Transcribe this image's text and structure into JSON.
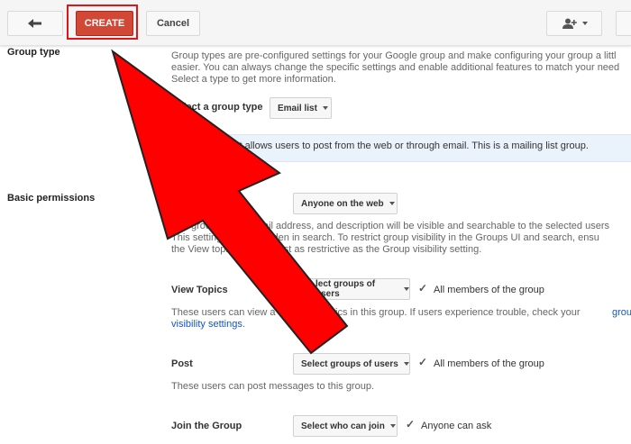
{
  "toolbar": {
    "back_icon": "arrow-left-icon",
    "create_label": "CREATE",
    "cancel_label": "Cancel",
    "people_icon": "person-add-icon",
    "accent": "#d14836",
    "highlight": "#e0151b"
  },
  "group_type": {
    "heading": "Group type",
    "desc_line1": "Group types are pre-configured settings for your Google group and make configuring your group a littl",
    "desc_line2": "easier. You can always change the specific settings and enable additional features to match your need",
    "desc_line3": "Select a type to get more information.",
    "select_label": "Select a group type",
    "select_value": "Email list",
    "info_text": "st allows users to post from the web or through email. This is a mailing list group."
  },
  "basic_permissions": {
    "heading": "Basic permissions",
    "visibility": {
      "label_fragment": "G",
      "select_value": "Anyone on the web",
      "desc_line1_a": "The group",
      "desc_line1_b": "ail address, and description will be visible and searchable to the selected users",
      "desc_line2_a": "This setting",
      "desc_line2_b": "idden in search. To restrict group visibility in the Groups UI and search, ensu",
      "desc_line3_a": "the View topic",
      "desc_line3_b": "t least as restrictive as the Group visibility setting."
    },
    "view_topics": {
      "label": "View Topics",
      "select_value": "lect groups of users",
      "check_label": "All members of the group",
      "desc_line1_a": "These users can view a",
      "desc_line1_b": "r topics in this group. If users experience trouble, check your",
      "desc_line1_link": "grou",
      "desc_line2_link": "visibility settings",
      "desc_line2_end": "."
    },
    "post": {
      "label": "Post",
      "select_value": "Select groups of users",
      "check_label": "All members of the group",
      "desc": "These users can post messages to this group."
    },
    "join": {
      "label": "Join the Group",
      "select_value": "Select who can join",
      "check_label": "Anyone can ask"
    }
  },
  "overlay": {
    "arrow_color": "#ff0000",
    "arrow_icon": "big-red-arrow"
  }
}
